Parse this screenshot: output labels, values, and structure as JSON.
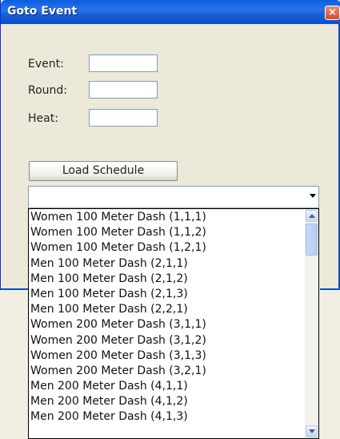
{
  "window": {
    "title": "Goto Event",
    "close_glyph": "×"
  },
  "form": {
    "event_label": "Event:",
    "event_value": "",
    "round_label": "Round:",
    "round_value": "",
    "heat_label": "Heat:",
    "heat_value": ""
  },
  "load_button": {
    "label": "Load Schedule"
  },
  "combo": {
    "selected_value": ""
  },
  "dropdown": {
    "items": [
      "Women 100 Meter Dash (1,1,1)",
      "Women 100 Meter Dash (1,1,2)",
      "Women 100 Meter Dash (1,2,1)",
      "Men 100 Meter Dash (2,1,1)",
      "Men 100 Meter Dash (2,1,2)",
      "Men 100 Meter Dash (2,1,3)",
      "Men 100 Meter Dash (2,2,1)",
      "Women 200 Meter Dash (3,1,1)",
      "Women 200 Meter Dash (3,1,2)",
      "Women 200 Meter Dash (3,1,3)",
      "Women 200 Meter Dash (3,2,1)",
      "Men 200 Meter Dash (4,1,1)",
      "Men 200 Meter Dash (4,1,2)",
      "Men 200 Meter Dash (4,1,3)"
    ]
  },
  "icons": {
    "combo_arrow": "chevron-down-icon",
    "scroll_up": "scroll-up-icon",
    "scroll_down": "scroll-down-icon"
  },
  "colors": {
    "titlebar": "#0a5fe0",
    "dialog_bg": "#ece9d8",
    "close_button": "#d6492c"
  }
}
